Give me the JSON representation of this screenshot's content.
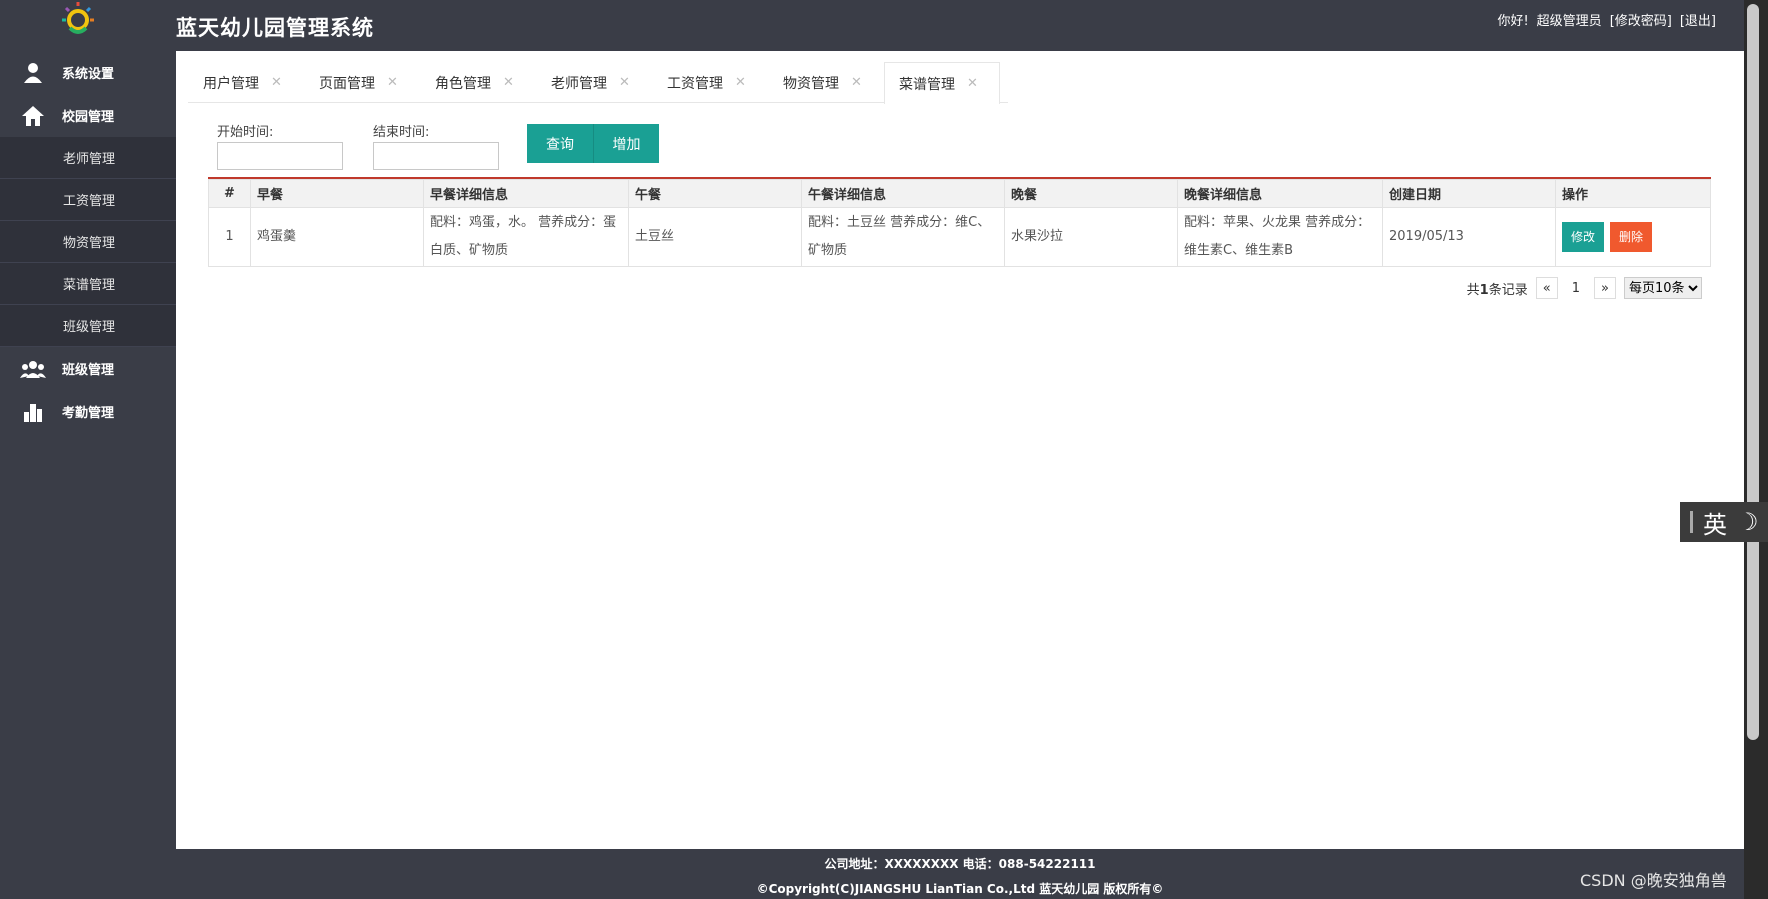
{
  "header": {
    "app_title": "蓝天幼儿园管理系统",
    "greeting": "你好!",
    "user_role": "超级管理员",
    "change_password": "[修改密码]",
    "logout": "[退出]"
  },
  "sidebar": {
    "groups": [
      {
        "label": "系统设置",
        "icon": "user-icon"
      },
      {
        "label": "校园管理",
        "icon": "home-icon"
      },
      {
        "label": "班级管理",
        "icon": "group-icon"
      },
      {
        "label": "考勤管理",
        "icon": "bar-chart-icon"
      }
    ],
    "sub_items": [
      "老师管理",
      "工资管理",
      "物资管理",
      "菜谱管理",
      "班级管理"
    ]
  },
  "tabs": [
    {
      "label": "用户管理"
    },
    {
      "label": "页面管理"
    },
    {
      "label": "角色管理"
    },
    {
      "label": "老师管理"
    },
    {
      "label": "工资管理"
    },
    {
      "label": "物资管理"
    },
    {
      "label": "菜谱管理"
    }
  ],
  "active_tab": "菜谱管理",
  "filter": {
    "start_label": "开始时间:",
    "end_label": "结束时间:",
    "start_value": "",
    "end_value": "",
    "query_button": "查询",
    "add_button": "增加"
  },
  "table": {
    "headers": [
      "#",
      "早餐",
      "早餐详细信息",
      "午餐",
      "午餐详细信息",
      "晚餐",
      "晚餐详细信息",
      "创建日期",
      "操作"
    ],
    "rows": [
      {
        "idx": "1",
        "breakfast": "鸡蛋羹",
        "breakfast_detail": "配料：鸡蛋，水。 营养成分：蛋白质、矿物质",
        "lunch": "土豆丝",
        "lunch_detail": "配料：土豆丝 营养成分：维C、矿物质",
        "dinner": "水果沙拉",
        "dinner_detail": "配料：苹果、火龙果 营养成分：维生素C、维生素B",
        "created": "2019/05/13",
        "edit_label": "修改",
        "delete_label": "删除"
      }
    ]
  },
  "pager": {
    "total_prefix": "共",
    "total_count": "1",
    "total_suffix": "条记录",
    "prev": "«",
    "page": "1",
    "next": "»",
    "per_page": "每页10条"
  },
  "footer": {
    "line1": "公司地址：XXXXXXXX 电话：088-54222111",
    "line2": "©Copyright(C)JIANGSHU LianTian Co.,Ltd 蓝天幼儿园 版权所有©"
  },
  "ime": {
    "label": "英"
  },
  "watermark": "CSDN @晚安独角兽",
  "colors": {
    "sidebar_bg": "#3a3d47",
    "accent_teal": "#1aa094",
    "danger_orange": "#f0592e",
    "table_top_border": "#c0392b"
  }
}
